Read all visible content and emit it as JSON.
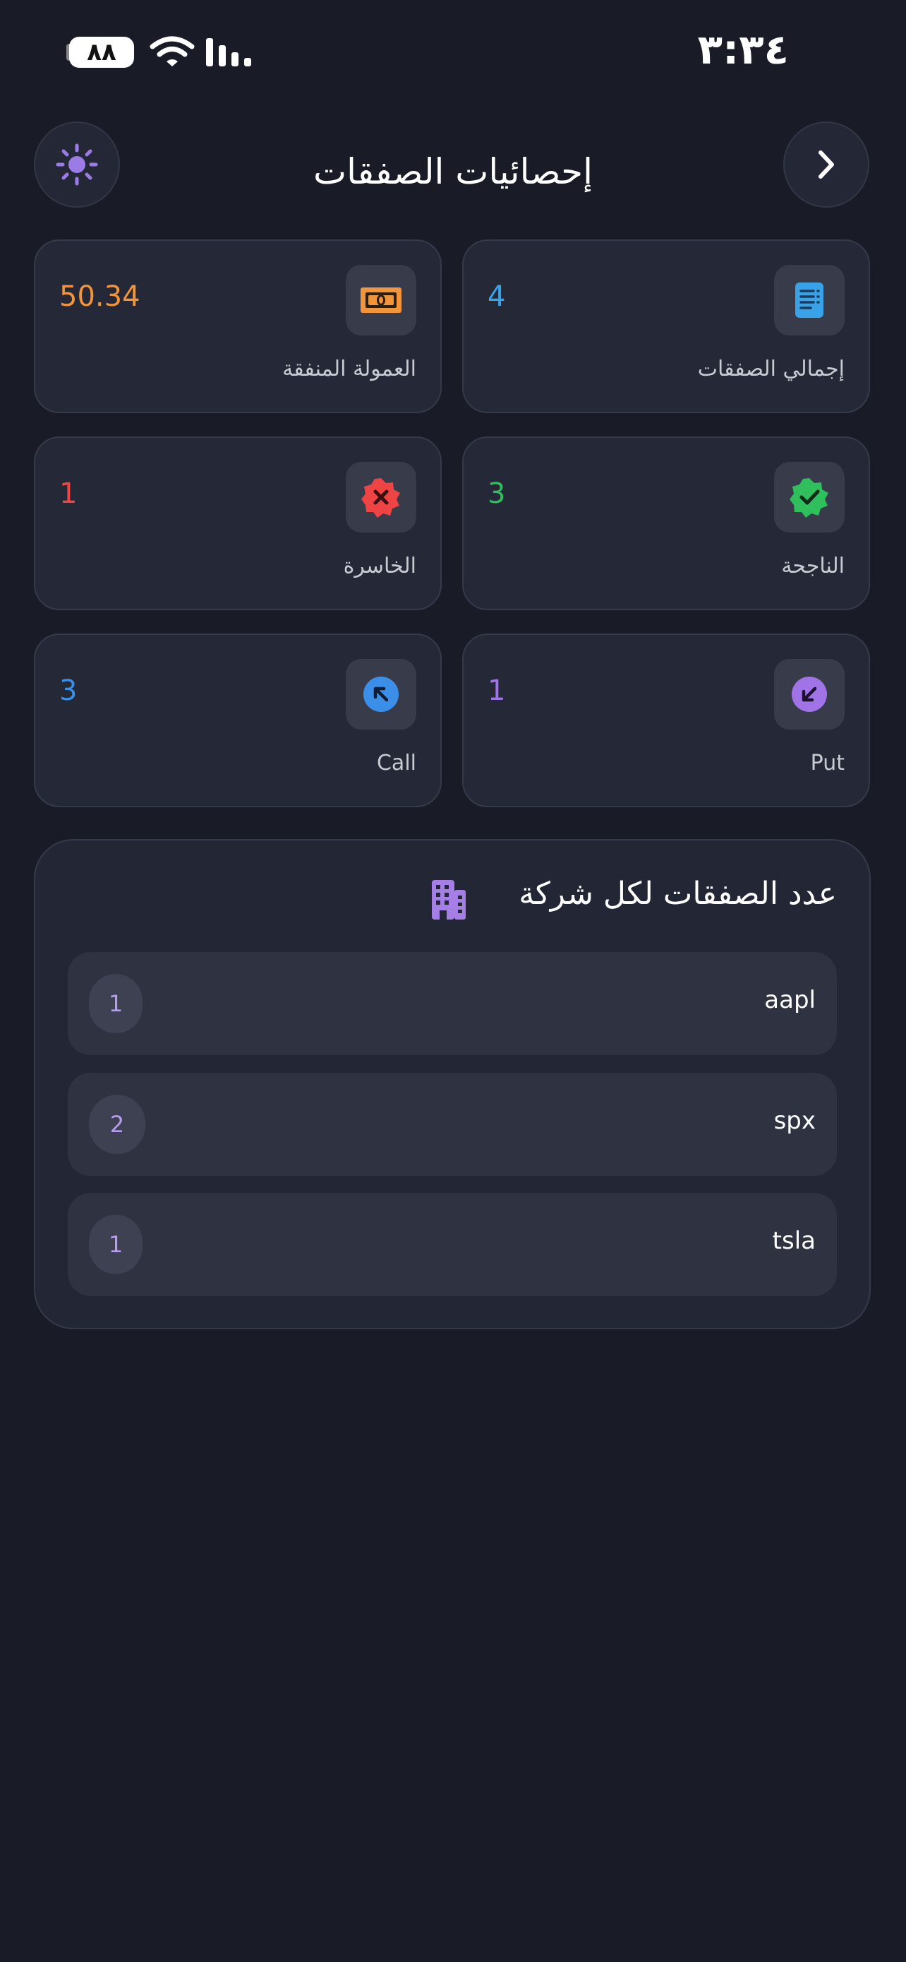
{
  "status_bar": {
    "time": "٣:٣٤",
    "battery": "٨٨"
  },
  "header": {
    "title": "إحصائيات الصفقات"
  },
  "stats": [
    {
      "label": "إجمالي الصفقات",
      "value": "4",
      "icon": "document-icon",
      "color": "#3aa3e8"
    },
    {
      "label": "العمولة المنفقة",
      "value": "50.34",
      "icon": "money-icon",
      "color": "#f2943a"
    },
    {
      "label": "الناجحة",
      "value": "3",
      "icon": "check-badge-icon",
      "color": "#2fbf5c"
    },
    {
      "label": "الخاسرة",
      "value": "1",
      "icon": "x-badge-icon",
      "color": "#ef4444"
    },
    {
      "label": "Put",
      "value": "1",
      "icon": "arrow-down-left-icon",
      "color": "#a073e6"
    },
    {
      "label": "Call",
      "value": "3",
      "icon": "arrow-up-left-icon",
      "color": "#3b8fe8"
    }
  ],
  "companies": {
    "title": "عدد الصفقات لكل شركة",
    "icon": "building-icon",
    "rows": [
      {
        "name": "aapl",
        "count": "1"
      },
      {
        "name": "spx",
        "count": "2"
      },
      {
        "name": "tsla",
        "count": "1"
      }
    ]
  }
}
